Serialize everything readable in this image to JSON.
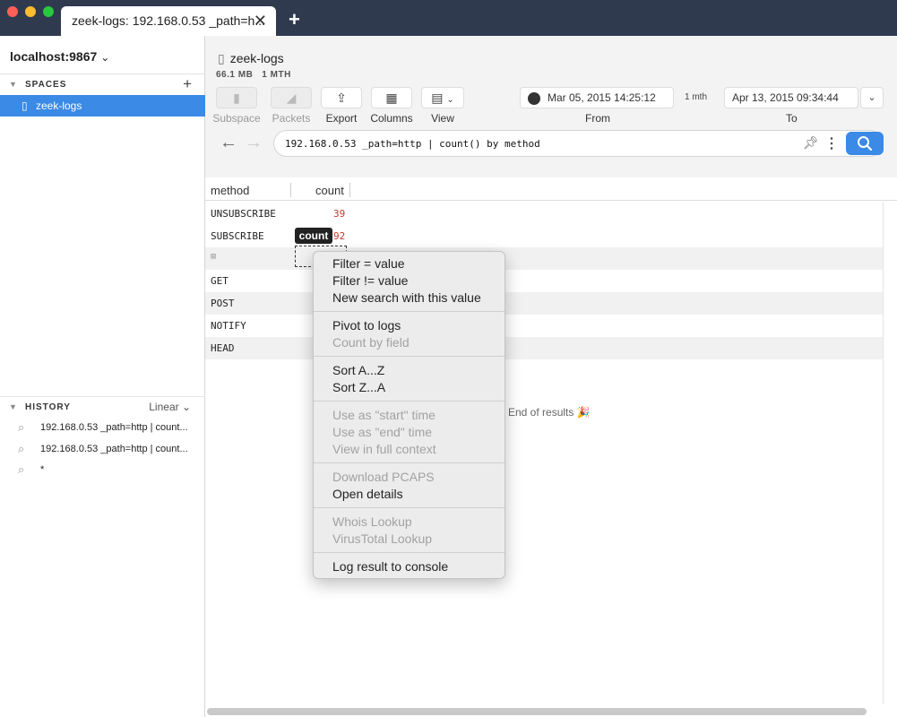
{
  "window": {
    "tab_title": "zeek-logs: 192.168.0.53 _path=h...",
    "tab_close": "✕",
    "new_tab": "+"
  },
  "sidebar": {
    "host": "localhost:9867",
    "spaces_label": "SPACES",
    "add_label": "+",
    "spaces": [
      {
        "label": "zeek-logs",
        "selected": true
      }
    ],
    "history_label": "HISTORY",
    "history_mode": "Linear",
    "history": [
      {
        "label": "192.168.0.53 _path=http | count..."
      },
      {
        "label": "192.168.0.53 _path=http | count..."
      },
      {
        "label": "*"
      }
    ]
  },
  "header": {
    "space_name": "zeek-logs",
    "size": "66.1 MB",
    "span": "1 MTH"
  },
  "toolbar": {
    "subspace": "Subspace",
    "packets": "Packets",
    "export": "Export",
    "columns": "Columns",
    "view": "View",
    "from_date": "Mar 05, 2015 14:25:12",
    "span_label": "1 mth",
    "to_date": "Apr 13, 2015 09:34:44",
    "from_label": "From",
    "to_label": "To"
  },
  "search": {
    "query": "192.168.0.53 _path=http | count() by method"
  },
  "table": {
    "columns": [
      "method",
      "count"
    ],
    "rows": [
      {
        "method": "UNSUBSCRIBE",
        "count": "39"
      },
      {
        "method": "SUBSCRIBE",
        "count": "92"
      },
      {
        "method": "⊠",
        "count": ""
      },
      {
        "method": "GET",
        "count": ""
      },
      {
        "method": "POST",
        "count": ""
      },
      {
        "method": "NOTIFY",
        "count": ""
      },
      {
        "method": "HEAD",
        "count": ""
      }
    ],
    "highlight_tag": "count",
    "end_text": "End of results 🎉"
  },
  "context_menu": {
    "items": [
      {
        "label": "Filter = value",
        "disabled": false
      },
      {
        "label": "Filter != value",
        "disabled": false
      },
      {
        "label": "New search with this value",
        "disabled": false
      },
      {
        "label": "Pivot to logs",
        "disabled": false
      },
      {
        "label": "Count by field",
        "disabled": true
      },
      {
        "label": "Sort A...Z",
        "disabled": false
      },
      {
        "label": "Sort Z...A",
        "disabled": false
      },
      {
        "label": "Use as \"start\" time",
        "disabled": true
      },
      {
        "label": "Use as \"end\" time",
        "disabled": true
      },
      {
        "label": "View in full context",
        "disabled": true
      },
      {
        "label": "Download PCAPS",
        "disabled": true
      },
      {
        "label": "Open details",
        "disabled": false
      },
      {
        "label": "Whois Lookup",
        "disabled": true
      },
      {
        "label": "VirusTotal Lookup",
        "disabled": true
      },
      {
        "label": "Log result to console",
        "disabled": false
      }
    ]
  },
  "colors": {
    "titlebar": "#2f3a4f",
    "accent": "#3a8ae6",
    "count_value": "#c8392b"
  }
}
